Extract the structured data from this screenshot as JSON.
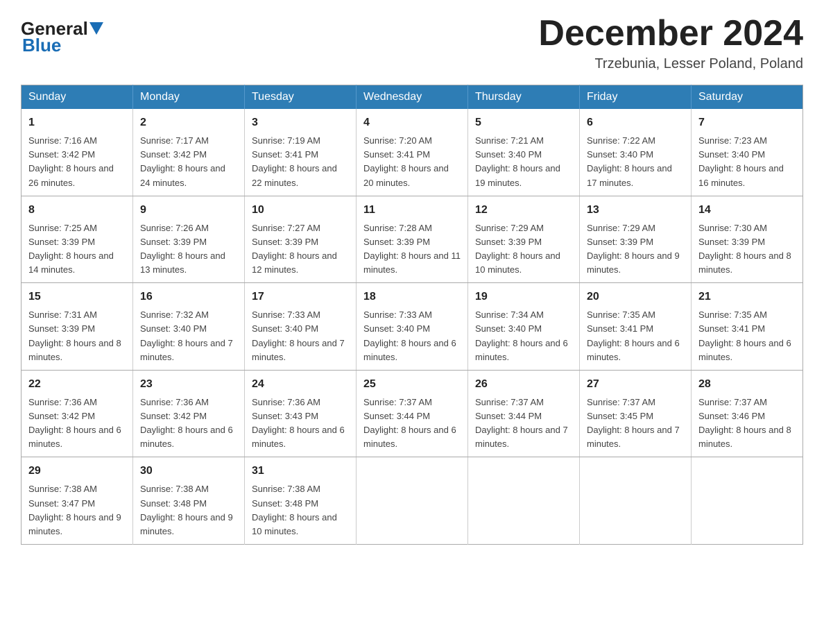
{
  "logo": {
    "general": "General",
    "blue": "Blue"
  },
  "title": "December 2024",
  "subtitle": "Trzebunia, Lesser Poland, Poland",
  "weekdays": [
    "Sunday",
    "Monday",
    "Tuesday",
    "Wednesday",
    "Thursday",
    "Friday",
    "Saturday"
  ],
  "weeks": [
    [
      {
        "day": "1",
        "sunrise": "7:16 AM",
        "sunset": "3:42 PM",
        "daylight": "8 hours and 26 minutes."
      },
      {
        "day": "2",
        "sunrise": "7:17 AM",
        "sunset": "3:42 PM",
        "daylight": "8 hours and 24 minutes."
      },
      {
        "day": "3",
        "sunrise": "7:19 AM",
        "sunset": "3:41 PM",
        "daylight": "8 hours and 22 minutes."
      },
      {
        "day": "4",
        "sunrise": "7:20 AM",
        "sunset": "3:41 PM",
        "daylight": "8 hours and 20 minutes."
      },
      {
        "day": "5",
        "sunrise": "7:21 AM",
        "sunset": "3:40 PM",
        "daylight": "8 hours and 19 minutes."
      },
      {
        "day": "6",
        "sunrise": "7:22 AM",
        "sunset": "3:40 PM",
        "daylight": "8 hours and 17 minutes."
      },
      {
        "day": "7",
        "sunrise": "7:23 AM",
        "sunset": "3:40 PM",
        "daylight": "8 hours and 16 minutes."
      }
    ],
    [
      {
        "day": "8",
        "sunrise": "7:25 AM",
        "sunset": "3:39 PM",
        "daylight": "8 hours and 14 minutes."
      },
      {
        "day": "9",
        "sunrise": "7:26 AM",
        "sunset": "3:39 PM",
        "daylight": "8 hours and 13 minutes."
      },
      {
        "day": "10",
        "sunrise": "7:27 AM",
        "sunset": "3:39 PM",
        "daylight": "8 hours and 12 minutes."
      },
      {
        "day": "11",
        "sunrise": "7:28 AM",
        "sunset": "3:39 PM",
        "daylight": "8 hours and 11 minutes."
      },
      {
        "day": "12",
        "sunrise": "7:29 AM",
        "sunset": "3:39 PM",
        "daylight": "8 hours and 10 minutes."
      },
      {
        "day": "13",
        "sunrise": "7:29 AM",
        "sunset": "3:39 PM",
        "daylight": "8 hours and 9 minutes."
      },
      {
        "day": "14",
        "sunrise": "7:30 AM",
        "sunset": "3:39 PM",
        "daylight": "8 hours and 8 minutes."
      }
    ],
    [
      {
        "day": "15",
        "sunrise": "7:31 AM",
        "sunset": "3:39 PM",
        "daylight": "8 hours and 8 minutes."
      },
      {
        "day": "16",
        "sunrise": "7:32 AM",
        "sunset": "3:40 PM",
        "daylight": "8 hours and 7 minutes."
      },
      {
        "day": "17",
        "sunrise": "7:33 AM",
        "sunset": "3:40 PM",
        "daylight": "8 hours and 7 minutes."
      },
      {
        "day": "18",
        "sunrise": "7:33 AM",
        "sunset": "3:40 PM",
        "daylight": "8 hours and 6 minutes."
      },
      {
        "day": "19",
        "sunrise": "7:34 AM",
        "sunset": "3:40 PM",
        "daylight": "8 hours and 6 minutes."
      },
      {
        "day": "20",
        "sunrise": "7:35 AM",
        "sunset": "3:41 PM",
        "daylight": "8 hours and 6 minutes."
      },
      {
        "day": "21",
        "sunrise": "7:35 AM",
        "sunset": "3:41 PM",
        "daylight": "8 hours and 6 minutes."
      }
    ],
    [
      {
        "day": "22",
        "sunrise": "7:36 AM",
        "sunset": "3:42 PM",
        "daylight": "8 hours and 6 minutes."
      },
      {
        "day": "23",
        "sunrise": "7:36 AM",
        "sunset": "3:42 PM",
        "daylight": "8 hours and 6 minutes."
      },
      {
        "day": "24",
        "sunrise": "7:36 AM",
        "sunset": "3:43 PM",
        "daylight": "8 hours and 6 minutes."
      },
      {
        "day": "25",
        "sunrise": "7:37 AM",
        "sunset": "3:44 PM",
        "daylight": "8 hours and 6 minutes."
      },
      {
        "day": "26",
        "sunrise": "7:37 AM",
        "sunset": "3:44 PM",
        "daylight": "8 hours and 7 minutes."
      },
      {
        "day": "27",
        "sunrise": "7:37 AM",
        "sunset": "3:45 PM",
        "daylight": "8 hours and 7 minutes."
      },
      {
        "day": "28",
        "sunrise": "7:37 AM",
        "sunset": "3:46 PM",
        "daylight": "8 hours and 8 minutes."
      }
    ],
    [
      {
        "day": "29",
        "sunrise": "7:38 AM",
        "sunset": "3:47 PM",
        "daylight": "8 hours and 9 minutes."
      },
      {
        "day": "30",
        "sunrise": "7:38 AM",
        "sunset": "3:48 PM",
        "daylight": "8 hours and 9 minutes."
      },
      {
        "day": "31",
        "sunrise": "7:38 AM",
        "sunset": "3:48 PM",
        "daylight": "8 hours and 10 minutes."
      },
      null,
      null,
      null,
      null
    ]
  ]
}
